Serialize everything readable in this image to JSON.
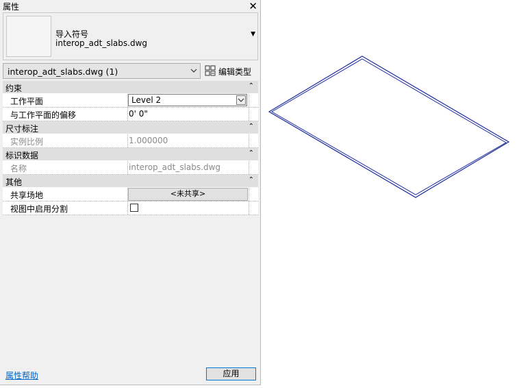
{
  "palette": {
    "title": "属性",
    "close_icon": "close-icon"
  },
  "preview": {
    "category": "导入符号",
    "type_name": "interop_adt_slabs.dwg"
  },
  "selector": {
    "value": "interop_adt_slabs.dwg (1)",
    "edit_type_label": "编辑类型"
  },
  "groups": [
    {
      "label": "约束",
      "rows": [
        {
          "name": "工作平面",
          "value": "Level 2"
        },
        {
          "name": "与工作平面的偏移",
          "value": "0'  0\""
        }
      ]
    },
    {
      "label": "尺寸标注",
      "rows": [
        {
          "name": "实例比例",
          "value": "1.000000"
        }
      ]
    },
    {
      "label": "标识数据",
      "rows": [
        {
          "name": "名称",
          "value": "interop_adt_slabs.dwg"
        }
      ]
    },
    {
      "label": "其他",
      "rows": [
        {
          "name": "共享场地",
          "value": "<未共享>"
        },
        {
          "name": "视图中启用分割",
          "value": false
        }
      ]
    }
  ],
  "footer": {
    "help_link": "属性帮助",
    "apply": "应用"
  },
  "colors": {
    "slab_outline": "#1a2a9a",
    "category_bg": "#dfdfdf",
    "apply_border": "#0078d7"
  }
}
